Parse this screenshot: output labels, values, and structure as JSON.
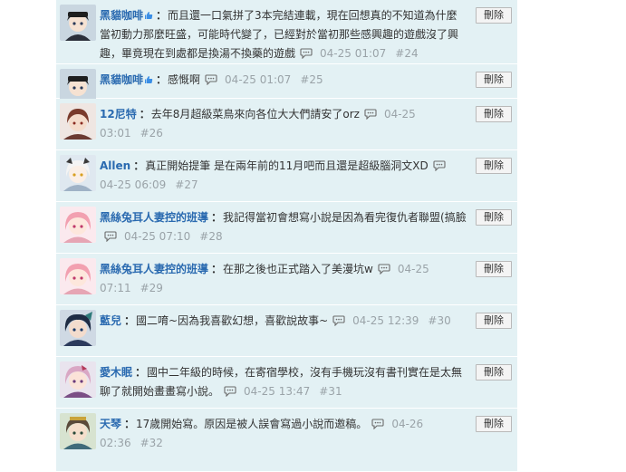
{
  "delete_label": "刪除",
  "replies": [
    {
      "user": "黑貓咖啡",
      "verified": true,
      "text": "而且還一口氣拼了3本完結連載，現在回想真的不知道為什麼當初動力那麼旺盛，可能時代變了，已經對於當初那些感興趣的遊戲沒了興趣，畢竟現在到處都是換湯不換藥的遊戲",
      "time": "04-25 01:07",
      "floor": "#24",
      "avatar": "avatar-a"
    },
    {
      "user": "黑貓咖啡",
      "verified": true,
      "text": "感慨啊",
      "time": "04-25 01:07",
      "floor": "#25",
      "avatar": "avatar-a"
    },
    {
      "user": "12尼特",
      "verified": false,
      "text": "去年8月超級菜鳥來向各位大大們請安了orz",
      "time": "04-25 03:01",
      "floor": "#26",
      "avatar": "avatar-b"
    },
    {
      "user": "Allen",
      "verified": false,
      "text": "真正開始提筆 是在兩年前的11月吧而且還是超級腦洞文XD",
      "time": "04-25 06:09",
      "floor": "#27",
      "avatar": "avatar-c"
    },
    {
      "user": "黑絲兔耳人妻控的班導",
      "verified": false,
      "text": "我記得當初會想寫小說是因為看完復仇者聯盟(搞臉",
      "time": "04-25 07:10",
      "floor": "#28",
      "avatar": "avatar-d"
    },
    {
      "user": "黑絲兔耳人妻控的班導",
      "verified": false,
      "text": "在那之後也正式踏入了美漫坑w",
      "time": "04-25 07:11",
      "floor": "#29",
      "avatar": "avatar-d"
    },
    {
      "user": "藍兒",
      "verified": false,
      "text": "國二唷~因為我喜歡幻想，喜歡說故事~",
      "time": "04-25 12:39",
      "floor": "#30",
      "avatar": "avatar-e"
    },
    {
      "user": "愛木眠",
      "verified": false,
      "text": "國中二年級的時候，在寄宿學校，沒有手機玩沒有書刊實在是太無聊了就開始畫畫寫小說。",
      "time": "04-25 13:47",
      "floor": "#31",
      "avatar": "avatar-f"
    },
    {
      "user": "天琴",
      "verified": false,
      "text": "17歲開始寫。原因是被人誤會寫過小說而邀稿。",
      "time": "04-26 02:36",
      "floor": "#32",
      "avatar": "avatar-g"
    }
  ],
  "colors": {
    "row_bg": "#e3f1f4",
    "username": "#2a6ab0",
    "meta": "#9aa3a8",
    "verified_badge": "#3a8ee6"
  }
}
